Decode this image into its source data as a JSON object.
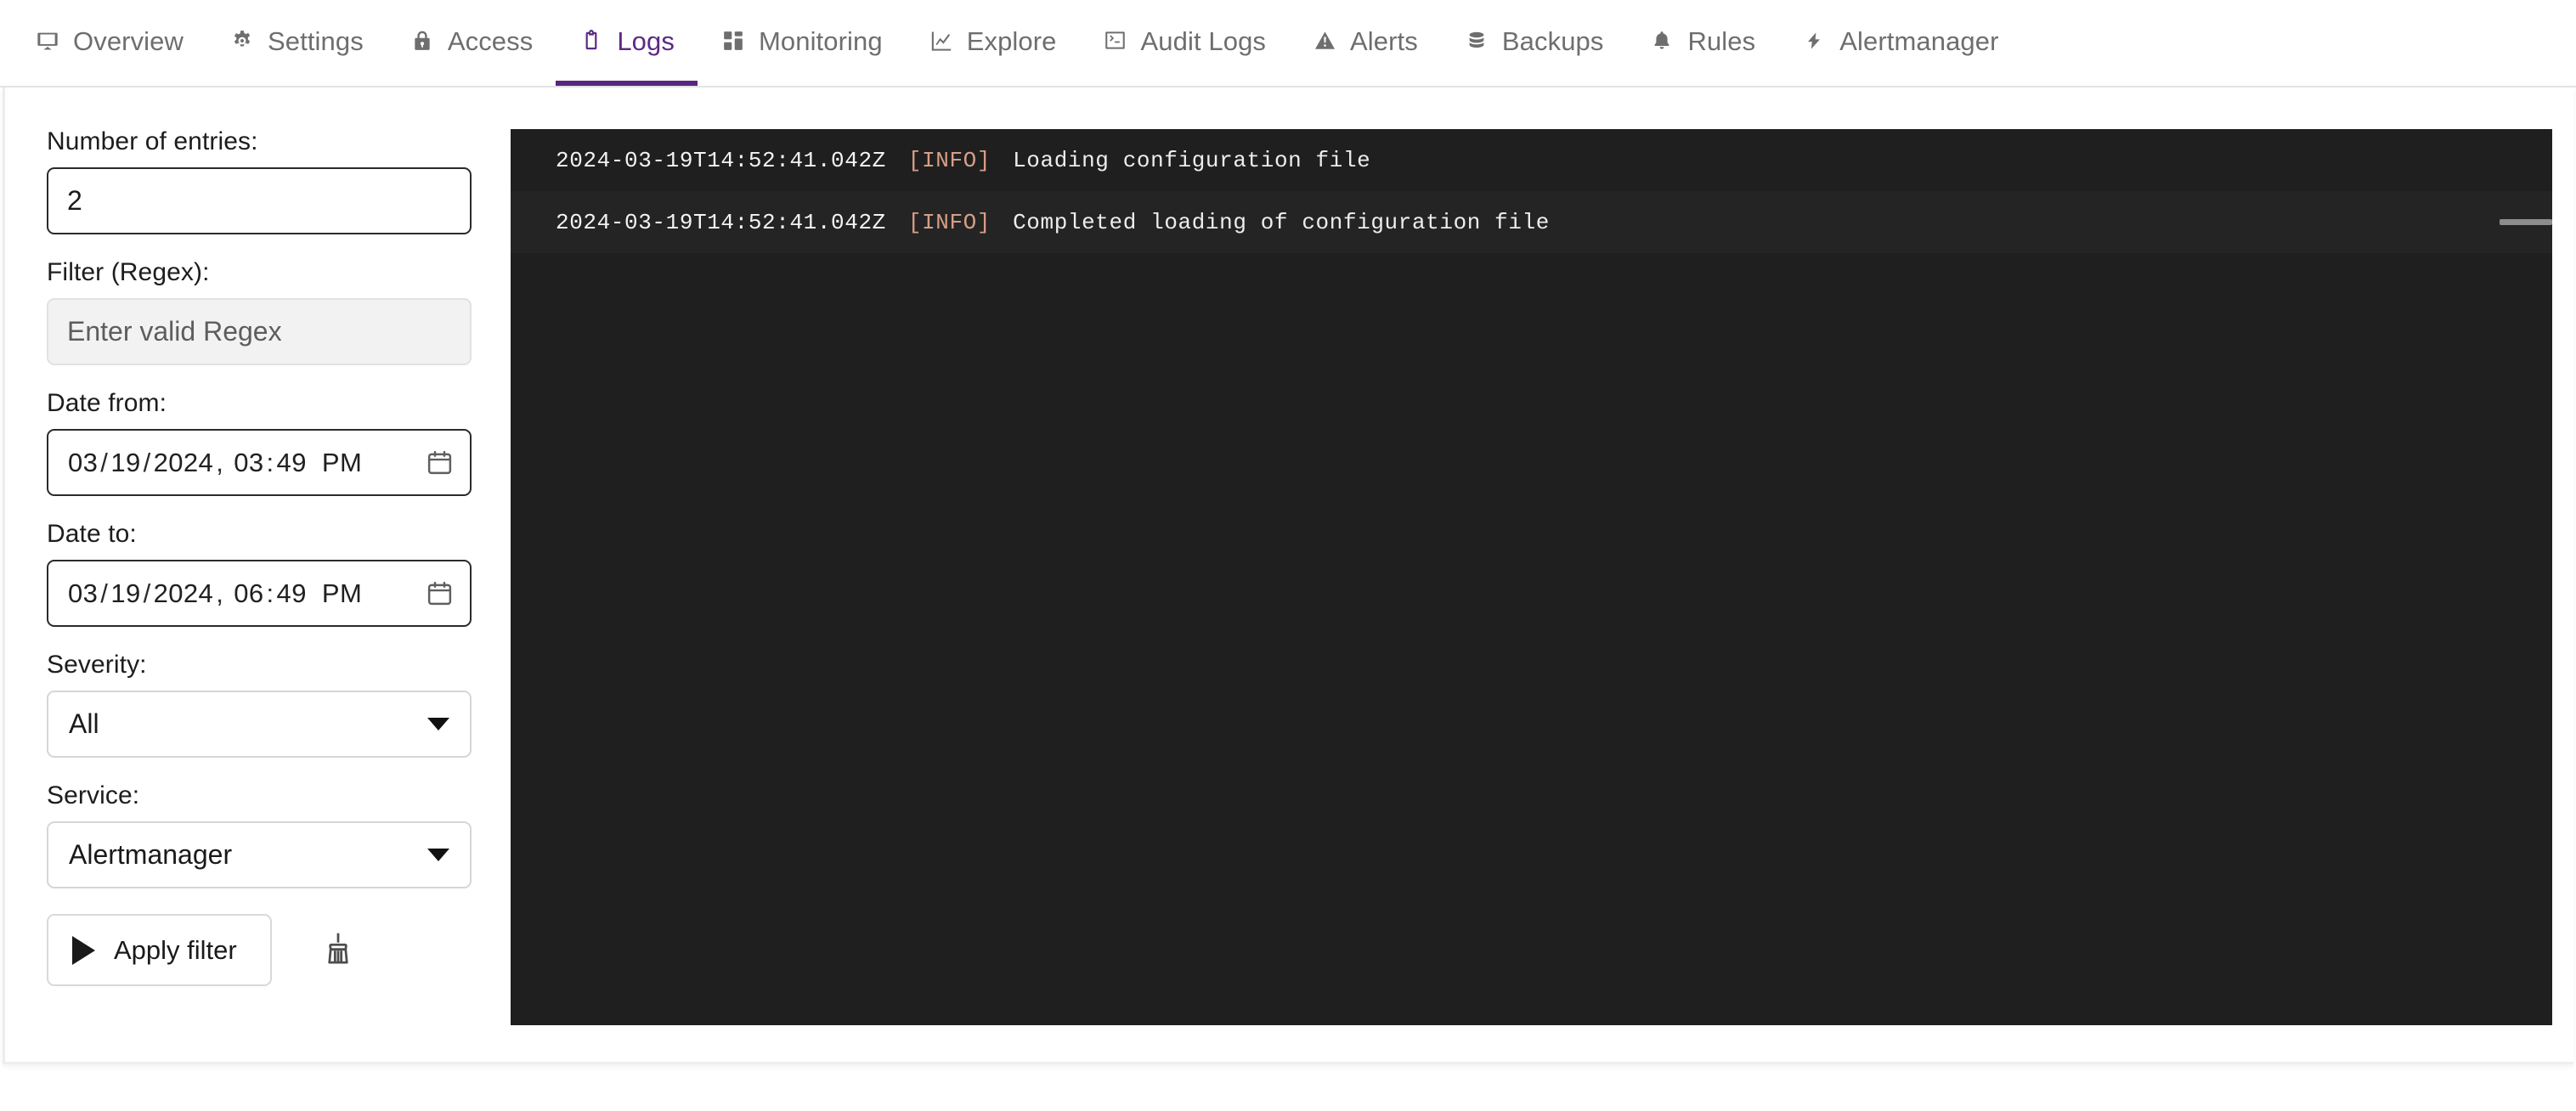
{
  "tabs": [
    {
      "label": "Overview",
      "icon": "monitor-icon",
      "active": false
    },
    {
      "label": "Settings",
      "icon": "gear-icon",
      "active": false
    },
    {
      "label": "Access",
      "icon": "lock-icon",
      "active": false
    },
    {
      "label": "Logs",
      "icon": "clipboard-icon",
      "active": true
    },
    {
      "label": "Monitoring",
      "icon": "dashboard-icon",
      "active": false
    },
    {
      "label": "Explore",
      "icon": "line-chart-icon",
      "active": false
    },
    {
      "label": "Audit Logs",
      "icon": "terminal-icon",
      "active": false
    },
    {
      "label": "Alerts",
      "icon": "warning-icon",
      "active": false
    },
    {
      "label": "Backups",
      "icon": "database-icon",
      "active": false
    },
    {
      "label": "Rules",
      "icon": "bell-icon",
      "active": false
    },
    {
      "label": "Alertmanager",
      "icon": "lightning-icon",
      "active": false
    }
  ],
  "filters": {
    "entries": {
      "label": "Number of entries:",
      "value": "2"
    },
    "regex": {
      "label": "Filter (Regex):",
      "value": "",
      "placeholder": "Enter valid Regex"
    },
    "date_from": {
      "label": "Date from:",
      "month": "03",
      "day": "19",
      "year": "2024",
      "hour": "03",
      "minute": "49",
      "meridiem": "PM",
      "icon": "calendar-icon"
    },
    "date_to": {
      "label": "Date to:",
      "month": "03",
      "day": "19",
      "year": "2024",
      "hour": "06",
      "minute": "49",
      "meridiem": "PM",
      "icon": "calendar-icon"
    },
    "severity": {
      "label": "Severity:",
      "value": "All",
      "options": [
        "All"
      ],
      "icon": "chevron-down-icon"
    },
    "service": {
      "label": "Service:",
      "value": "Alertmanager",
      "options": [
        "Alertmanager"
      ],
      "icon": "chevron-down-icon"
    },
    "apply_button": {
      "label": "Apply filter",
      "icon": "play-icon"
    },
    "clear_button": {
      "icon": "broom-icon"
    }
  },
  "console": {
    "lines": [
      {
        "timestamp": "2024-03-19T14:52:41.042Z",
        "severity": "[INFO]",
        "message": "Loading configuration file",
        "highlight": false
      },
      {
        "timestamp": "2024-03-19T14:52:41.042Z",
        "severity": "[INFO]",
        "message": "Completed loading of configuration file",
        "highlight": true
      }
    ]
  },
  "colors": {
    "accent_purple": "#59257f",
    "tab_inactive": "#6e6e6e",
    "console_bg": "#1f1f1f",
    "severity_info": "#d79e87",
    "console_text": "#f0f0f0"
  }
}
